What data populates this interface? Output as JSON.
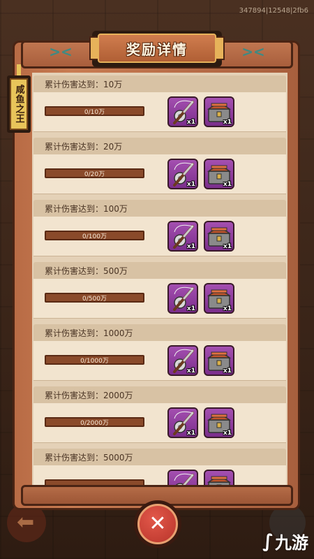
{
  "build_id": "347894|12548|2fb6",
  "title": "奖励详情",
  "side_tag": "咸鱼之王",
  "rewards": [
    {
      "label": "累计伤害达到：10万",
      "progress_text": "0/10万",
      "progress": 0,
      "rod_qty": "x1",
      "chest_qty": "x1"
    },
    {
      "label": "累计伤害达到：20万",
      "progress_text": "0/20万",
      "progress": 0,
      "rod_qty": "x1",
      "chest_qty": "x1"
    },
    {
      "label": "累计伤害达到：100万",
      "progress_text": "0/100万",
      "progress": 0,
      "rod_qty": "x1",
      "chest_qty": "x1"
    },
    {
      "label": "累计伤害达到：500万",
      "progress_text": "0/500万",
      "progress": 0,
      "rod_qty": "x1",
      "chest_qty": "x1"
    },
    {
      "label": "累计伤害达到：1000万",
      "progress_text": "0/1000万",
      "progress": 0,
      "rod_qty": "x1",
      "chest_qty": "x1"
    },
    {
      "label": "累计伤害达到：2000万",
      "progress_text": "0/2000万",
      "progress": 0,
      "rod_qty": "x1",
      "chest_qty": "x1"
    },
    {
      "label": "累计伤害达到：5000万",
      "progress_text": "",
      "progress": 0,
      "rod_qty": "",
      "chest_qty": ""
    }
  ],
  "icons": {
    "reward_1": "fishing-rod-icon",
    "reward_2": "treasure-chest-icon",
    "close": "close-icon",
    "header_decor": "fish-icon"
  },
  "watermark": "九游",
  "colors": {
    "panel_wood": "#c97c52",
    "title_gold": "#e7b25a",
    "reward_purple": "#a44fb0",
    "close_red": "#d2483c"
  }
}
